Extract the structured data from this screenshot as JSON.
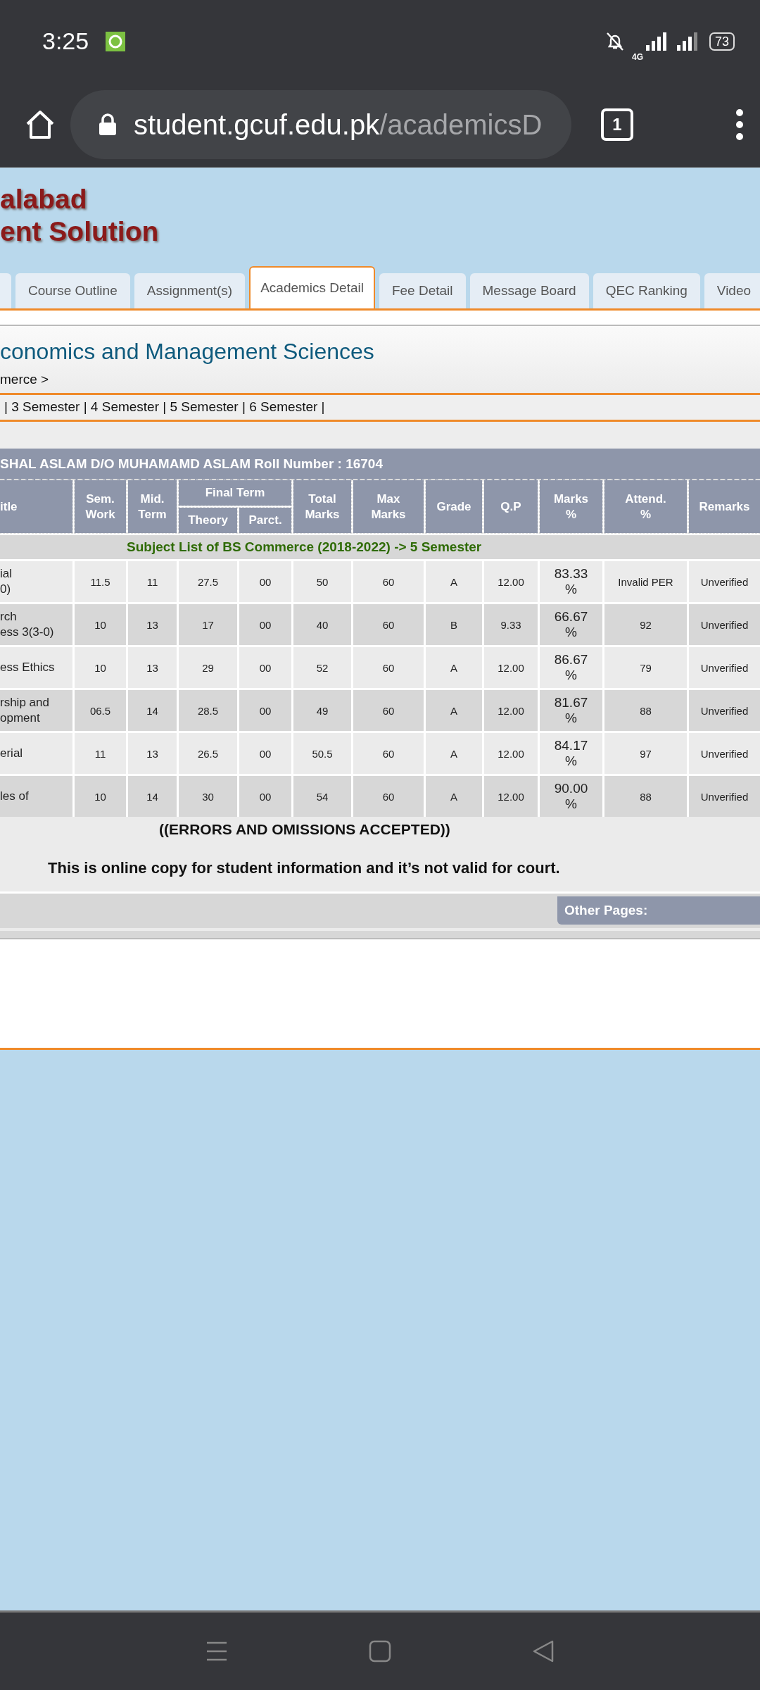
{
  "status_bar": {
    "time": "3:25",
    "network": "4G",
    "battery": "73"
  },
  "browser": {
    "url_host": "student.gcuf.edu.pk",
    "url_path": "/academicsD",
    "tab_count": "1"
  },
  "site_header": {
    "title_lines": [
      "alabad",
      "ent Solution"
    ]
  },
  "tabs": [
    {
      "label": "Course Outline",
      "selected": false
    },
    {
      "label": "Assignment(s)",
      "selected": false
    },
    {
      "label": "Academics Detail",
      "selected": true
    },
    {
      "label": "Fee Detail",
      "selected": false
    },
    {
      "label": "Message Board",
      "selected": false
    },
    {
      "label": "QEC Ranking",
      "selected": false
    },
    {
      "label": "Video",
      "selected": false
    }
  ],
  "faculty": {
    "title": "conomics and Management Sciences",
    "breadcrumb": "merce >"
  },
  "semester_links": "| 3 Semester | 4 Semester | 5 Semester | 6 Semester |",
  "student_bar": "SHAL ASLAM D/O MUHAMAMD ASLAM Roll Number : 16704",
  "table": {
    "columns": [
      {
        "kind": "single",
        "label": "itle"
      },
      {
        "kind": "single",
        "label": "Sem.\nWork"
      },
      {
        "kind": "single",
        "label": "Mid.\nTerm"
      },
      {
        "kind": "sub",
        "label": "Theory"
      },
      {
        "kind": "sub",
        "label": "Parct."
      },
      {
        "kind": "single",
        "label": "Total\nMarks"
      },
      {
        "kind": "single",
        "label": "Max\nMarks"
      },
      {
        "kind": "single",
        "label": "Grade"
      },
      {
        "kind": "single",
        "label": "Q.P"
      },
      {
        "kind": "single",
        "label": "Marks\n%"
      },
      {
        "kind": "single",
        "label": "Attend.\n%"
      },
      {
        "kind": "single",
        "label": "Remarks"
      }
    ],
    "group_header": "Final Term",
    "subject_list_title": "Subject List of BS Commerce (2018-2022) -> 5 Semester",
    "rows": [
      {
        "cells": [
          "ial\n0)",
          "11.5",
          "11",
          "27.5",
          "00",
          "50",
          "60",
          "A",
          "12.00",
          "83.33\n%",
          "Invalid PER",
          "Unverified"
        ]
      },
      {
        "cells": [
          "rch\ness 3(3-0)",
          "10",
          "13",
          "17",
          "00",
          "40",
          "60",
          "B",
          "9.33",
          "66.67\n%",
          "92",
          "Unverified"
        ]
      },
      {
        "cells": [
          "ess Ethics",
          "10",
          "13",
          "29",
          "00",
          "52",
          "60",
          "A",
          "12.00",
          "86.67\n%",
          "79",
          "Unverified"
        ]
      },
      {
        "cells": [
          "rship and\nopment",
          "06.5",
          "14",
          "28.5",
          "00",
          "49",
          "60",
          "A",
          "12.00",
          "81.67\n%",
          "88",
          "Unverified"
        ]
      },
      {
        "cells": [
          "erial",
          "11",
          "13",
          "26.5",
          "00",
          "50.5",
          "60",
          "A",
          "12.00",
          "84.17\n%",
          "97",
          "Unverified"
        ]
      },
      {
        "cells": [
          "les of",
          "10",
          "14",
          "30",
          "00",
          "54",
          "60",
          "A",
          "12.00",
          "90.00\n%",
          "88",
          "Unverified"
        ]
      }
    ]
  },
  "notes": [
    "((ERRORS AND OMISSIONS ACCEPTED))",
    "This is online copy for student information and it’s not valid for court."
  ],
  "other_pages": "Other Pages:"
}
